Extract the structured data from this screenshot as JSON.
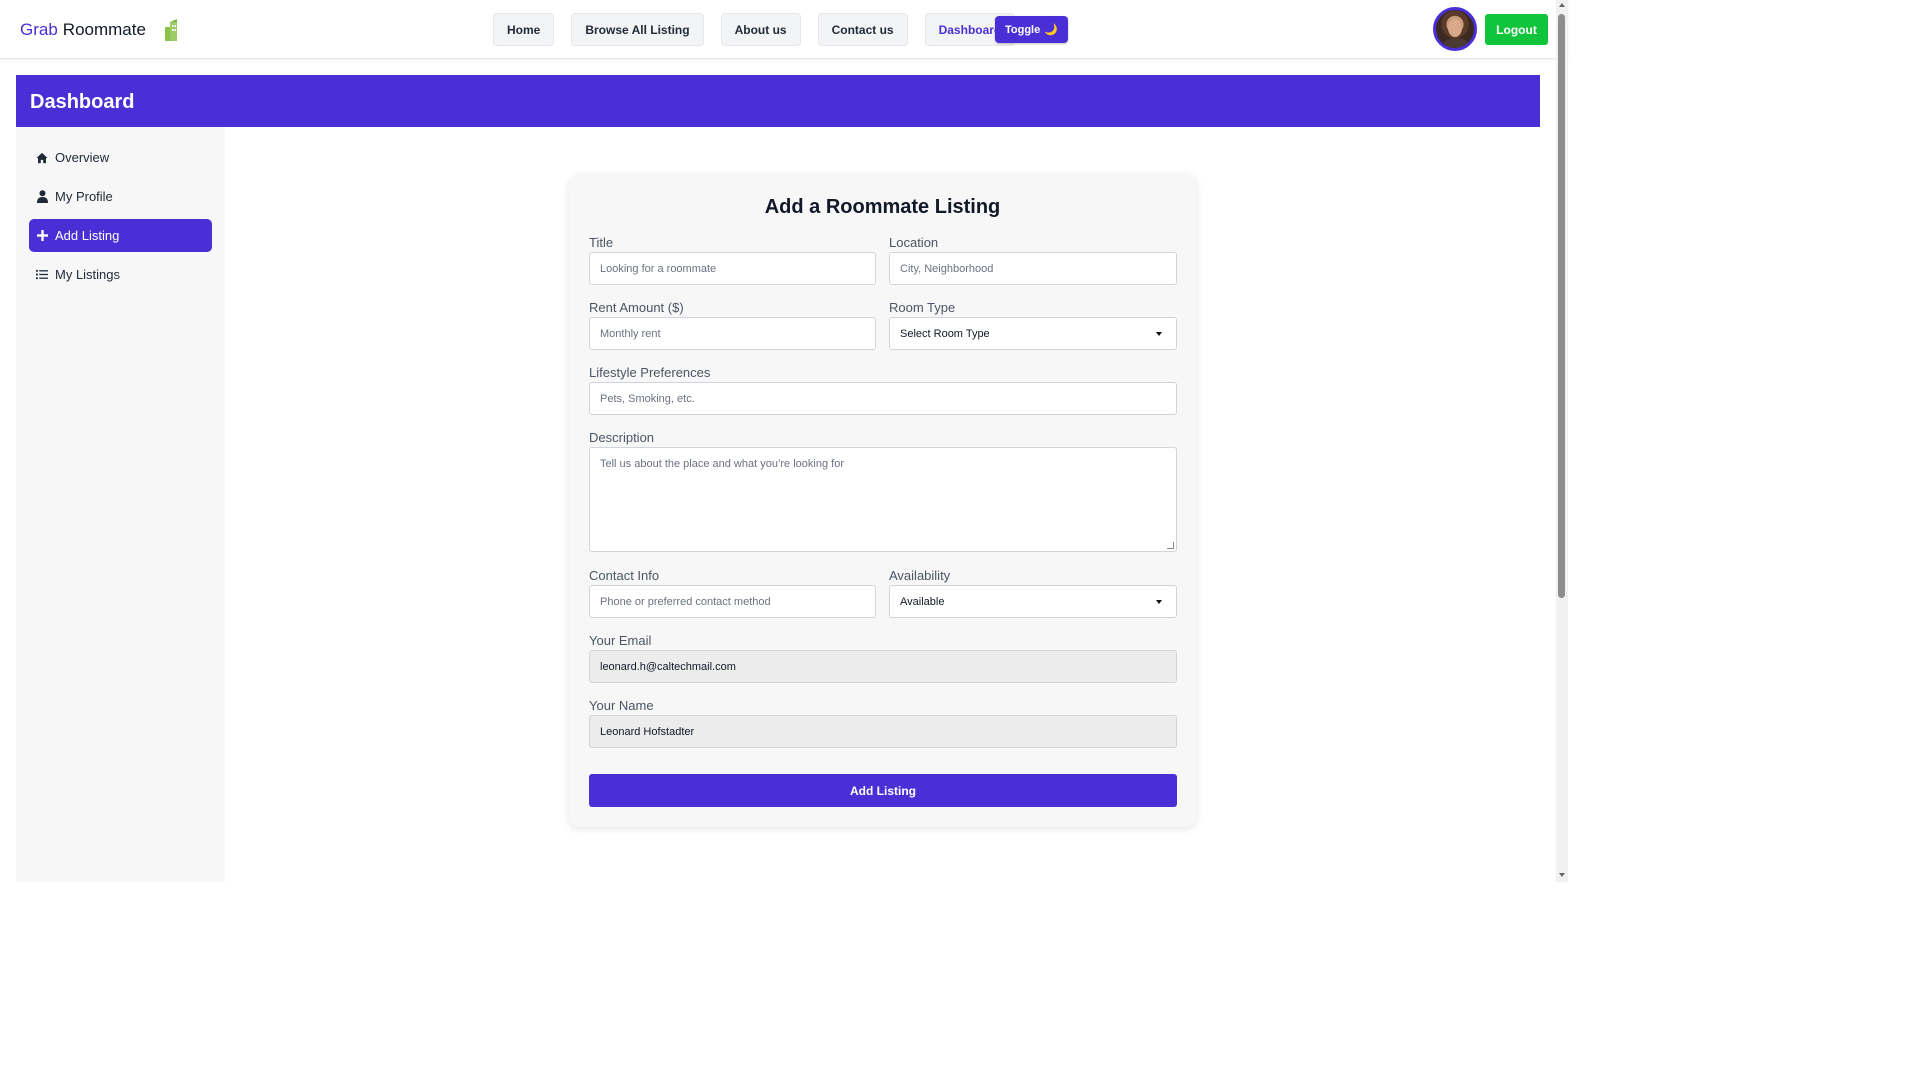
{
  "brand": {
    "part1": "Grab",
    "part2": "Roommate"
  },
  "nav": {
    "items": [
      {
        "label": "Home"
      },
      {
        "label": "Browse All Listing"
      },
      {
        "label": "About us"
      },
      {
        "label": "Contact us"
      },
      {
        "label": "Dashboard",
        "active": true
      }
    ],
    "toggle_label": "Toggle",
    "toggle_icon": "🌙",
    "logout_label": "Logout"
  },
  "dashboard": {
    "title": "Dashboard"
  },
  "sidebar": {
    "items": [
      {
        "label": "Overview",
        "icon": "home-icon"
      },
      {
        "label": "My Profile",
        "icon": "user-icon"
      },
      {
        "label": "Add Listing",
        "icon": "plus-icon",
        "active": true
      },
      {
        "label": "My Listings",
        "icon": "list-icon"
      }
    ]
  },
  "form": {
    "title": "Add a Roommate Listing",
    "title_field": {
      "label": "Title",
      "placeholder": "Looking for a roommate"
    },
    "location": {
      "label": "Location",
      "placeholder": "City, Neighborhood"
    },
    "rent": {
      "label": "Rent Amount ($)",
      "placeholder": "Monthly rent"
    },
    "room_type": {
      "label": "Room Type",
      "value": "Select Room Type"
    },
    "lifestyle": {
      "label": "Lifestyle Preferences",
      "placeholder": "Pets, Smoking, etc."
    },
    "description": {
      "label": "Description",
      "placeholder": "Tell us about the place and what you’re looking for"
    },
    "contact": {
      "label": "Contact Info",
      "placeholder": "Phone or preferred contact method"
    },
    "availability": {
      "label": "Availability",
      "value": "Available"
    },
    "email": {
      "label": "Your Email",
      "value": "leonard.h@caltechmail.com"
    },
    "name": {
      "label": "Your Name",
      "value": "Leonard Hofstadter"
    },
    "submit_label": "Add Listing"
  },
  "colors": {
    "accent": "#4a2fd6",
    "logout": "#10c43c"
  }
}
